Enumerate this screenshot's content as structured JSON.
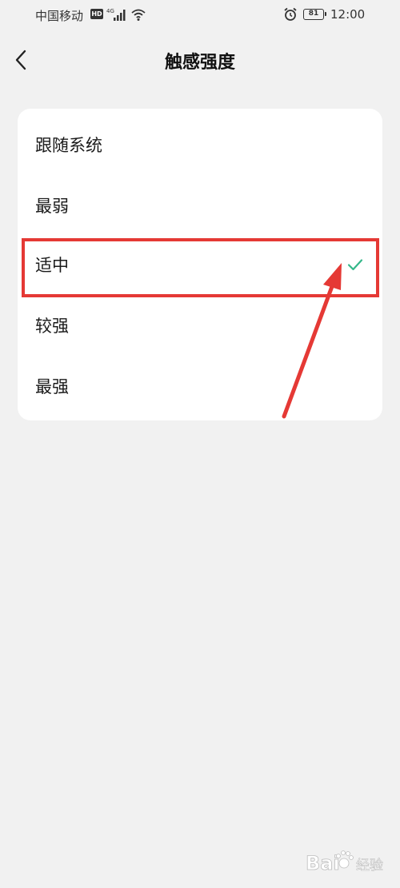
{
  "status_bar": {
    "carrier": "中国移动",
    "hd": "HD",
    "battery": "81",
    "time": "12:00"
  },
  "header": {
    "title": "触感强度"
  },
  "options": [
    {
      "label": "跟随系统",
      "selected": false
    },
    {
      "label": "最弱",
      "selected": false
    },
    {
      "label": "适中",
      "selected": true
    },
    {
      "label": "较强",
      "selected": false
    },
    {
      "label": "最强",
      "selected": false
    }
  ],
  "colors": {
    "accent": "#35b88a",
    "annotation": "#e53935",
    "background": "#f1f1f1",
    "card": "#ffffff"
  },
  "watermark": {
    "brand": "Bai",
    "suffix": "经验"
  }
}
